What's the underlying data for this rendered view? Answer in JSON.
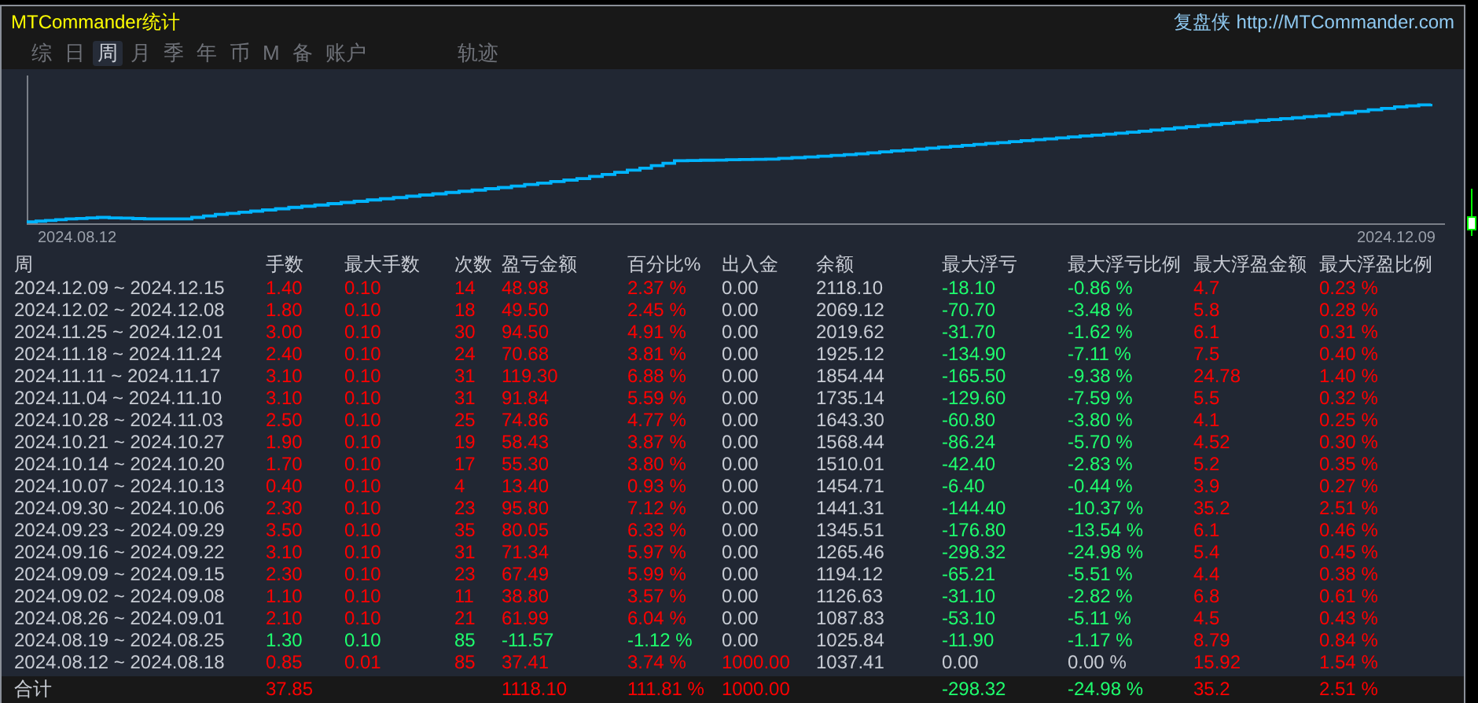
{
  "window": {
    "title": "MTCommander统计",
    "brand": "复盘侠",
    "link": "http://MTCommander.com"
  },
  "tabs": [
    {
      "label": "综",
      "selected": false
    },
    {
      "label": "日",
      "selected": false
    },
    {
      "label": "周",
      "selected": true
    },
    {
      "label": "月",
      "selected": false
    },
    {
      "label": "季",
      "selected": false
    },
    {
      "label": "年",
      "selected": false
    },
    {
      "label": "币",
      "selected": false
    },
    {
      "label": "M",
      "selected": false
    },
    {
      "label": "备",
      "selected": false
    },
    {
      "label": "账户",
      "selected": false
    },
    {
      "label": "轨迹",
      "selected": false
    }
  ],
  "chart": {
    "start_label": "2024.08.12",
    "end_label": "2024.12.09"
  },
  "table": {
    "columns": [
      "周",
      "手数",
      "最大手数",
      "次数",
      "盈亏金额",
      "百分比%",
      "出入金",
      "余额",
      "最大浮亏",
      "最大浮亏比例",
      "最大浮盈金额",
      "最大浮盈比例"
    ],
    "rows": [
      {
        "cells": [
          {
            "text": "2024.12.09 ~ 2024.12.15",
            "color": "#c8ccd4"
          },
          {
            "text": "1.40",
            "color": "#ff0000"
          },
          {
            "text": "0.10",
            "color": "#ff0000"
          },
          {
            "text": "14",
            "color": "#ff0000"
          },
          {
            "text": "48.98",
            "color": "#ff0000"
          },
          {
            "text": "2.37 %",
            "color": "#ff0000"
          },
          {
            "text": "0.00",
            "color": "#c8ccd4"
          },
          {
            "text": "2118.10",
            "color": "#c8ccd4"
          },
          {
            "text": "-18.10",
            "color": "#1eff6e"
          },
          {
            "text": "-0.86 %",
            "color": "#1eff6e"
          },
          {
            "text": "4.7",
            "color": "#ff0000"
          },
          {
            "text": "0.23 %",
            "color": "#ff0000"
          }
        ]
      },
      {
        "cells": [
          {
            "text": "2024.12.02 ~ 2024.12.08",
            "color": "#c8ccd4"
          },
          {
            "text": "1.80",
            "color": "#ff0000"
          },
          {
            "text": "0.10",
            "color": "#ff0000"
          },
          {
            "text": "18",
            "color": "#ff0000"
          },
          {
            "text": "49.50",
            "color": "#ff0000"
          },
          {
            "text": "2.45 %",
            "color": "#ff0000"
          },
          {
            "text": "0.00",
            "color": "#c8ccd4"
          },
          {
            "text": "2069.12",
            "color": "#c8ccd4"
          },
          {
            "text": "-70.70",
            "color": "#1eff6e"
          },
          {
            "text": "-3.48 %",
            "color": "#1eff6e"
          },
          {
            "text": "5.8",
            "color": "#ff0000"
          },
          {
            "text": "0.28 %",
            "color": "#ff0000"
          }
        ]
      },
      {
        "cells": [
          {
            "text": "2024.11.25 ~ 2024.12.01",
            "color": "#c8ccd4"
          },
          {
            "text": "3.00",
            "color": "#ff0000"
          },
          {
            "text": "0.10",
            "color": "#ff0000"
          },
          {
            "text": "30",
            "color": "#ff0000"
          },
          {
            "text": "94.50",
            "color": "#ff0000"
          },
          {
            "text": "4.91 %",
            "color": "#ff0000"
          },
          {
            "text": "0.00",
            "color": "#c8ccd4"
          },
          {
            "text": "2019.62",
            "color": "#c8ccd4"
          },
          {
            "text": "-31.70",
            "color": "#1eff6e"
          },
          {
            "text": "-1.62 %",
            "color": "#1eff6e"
          },
          {
            "text": "6.1",
            "color": "#ff0000"
          },
          {
            "text": "0.31 %",
            "color": "#ff0000"
          }
        ]
      },
      {
        "cells": [
          {
            "text": "2024.11.18 ~ 2024.11.24",
            "color": "#c8ccd4"
          },
          {
            "text": "2.40",
            "color": "#ff0000"
          },
          {
            "text": "0.10",
            "color": "#ff0000"
          },
          {
            "text": "24",
            "color": "#ff0000"
          },
          {
            "text": "70.68",
            "color": "#ff0000"
          },
          {
            "text": "3.81 %",
            "color": "#ff0000"
          },
          {
            "text": "0.00",
            "color": "#c8ccd4"
          },
          {
            "text": "1925.12",
            "color": "#c8ccd4"
          },
          {
            "text": "-134.90",
            "color": "#1eff6e"
          },
          {
            "text": "-7.11 %",
            "color": "#1eff6e"
          },
          {
            "text": "7.5",
            "color": "#ff0000"
          },
          {
            "text": "0.40 %",
            "color": "#ff0000"
          }
        ]
      },
      {
        "cells": [
          {
            "text": "2024.11.11 ~ 2024.11.17",
            "color": "#c8ccd4"
          },
          {
            "text": "3.10",
            "color": "#ff0000"
          },
          {
            "text": "0.10",
            "color": "#ff0000"
          },
          {
            "text": "31",
            "color": "#ff0000"
          },
          {
            "text": "119.30",
            "color": "#ff0000"
          },
          {
            "text": "6.88 %",
            "color": "#ff0000"
          },
          {
            "text": "0.00",
            "color": "#c8ccd4"
          },
          {
            "text": "1854.44",
            "color": "#c8ccd4"
          },
          {
            "text": "-165.50",
            "color": "#1eff6e"
          },
          {
            "text": "-9.38 %",
            "color": "#1eff6e"
          },
          {
            "text": "24.78",
            "color": "#ff0000"
          },
          {
            "text": "1.40 %",
            "color": "#ff0000"
          }
        ]
      },
      {
        "cells": [
          {
            "text": "2024.11.04 ~ 2024.11.10",
            "color": "#c8ccd4"
          },
          {
            "text": "3.10",
            "color": "#ff0000"
          },
          {
            "text": "0.10",
            "color": "#ff0000"
          },
          {
            "text": "31",
            "color": "#ff0000"
          },
          {
            "text": "91.84",
            "color": "#ff0000"
          },
          {
            "text": "5.59 %",
            "color": "#ff0000"
          },
          {
            "text": "0.00",
            "color": "#c8ccd4"
          },
          {
            "text": "1735.14",
            "color": "#c8ccd4"
          },
          {
            "text": "-129.60",
            "color": "#1eff6e"
          },
          {
            "text": "-7.59 %",
            "color": "#1eff6e"
          },
          {
            "text": "5.5",
            "color": "#ff0000"
          },
          {
            "text": "0.32 %",
            "color": "#ff0000"
          }
        ]
      },
      {
        "cells": [
          {
            "text": "2024.10.28 ~ 2024.11.03",
            "color": "#c8ccd4"
          },
          {
            "text": "2.50",
            "color": "#ff0000"
          },
          {
            "text": "0.10",
            "color": "#ff0000"
          },
          {
            "text": "25",
            "color": "#ff0000"
          },
          {
            "text": "74.86",
            "color": "#ff0000"
          },
          {
            "text": "4.77 %",
            "color": "#ff0000"
          },
          {
            "text": "0.00",
            "color": "#c8ccd4"
          },
          {
            "text": "1643.30",
            "color": "#c8ccd4"
          },
          {
            "text": "-60.80",
            "color": "#1eff6e"
          },
          {
            "text": "-3.80 %",
            "color": "#1eff6e"
          },
          {
            "text": "4.1",
            "color": "#ff0000"
          },
          {
            "text": "0.25 %",
            "color": "#ff0000"
          }
        ]
      },
      {
        "cells": [
          {
            "text": "2024.10.21 ~ 2024.10.27",
            "color": "#c8ccd4"
          },
          {
            "text": "1.90",
            "color": "#ff0000"
          },
          {
            "text": "0.10",
            "color": "#ff0000"
          },
          {
            "text": "19",
            "color": "#ff0000"
          },
          {
            "text": "58.43",
            "color": "#ff0000"
          },
          {
            "text": "3.87 %",
            "color": "#ff0000"
          },
          {
            "text": "0.00",
            "color": "#c8ccd4"
          },
          {
            "text": "1568.44",
            "color": "#c8ccd4"
          },
          {
            "text": "-86.24",
            "color": "#1eff6e"
          },
          {
            "text": "-5.70 %",
            "color": "#1eff6e"
          },
          {
            "text": "4.52",
            "color": "#ff0000"
          },
          {
            "text": "0.30 %",
            "color": "#ff0000"
          }
        ]
      },
      {
        "cells": [
          {
            "text": "2024.10.14 ~ 2024.10.20",
            "color": "#c8ccd4"
          },
          {
            "text": "1.70",
            "color": "#ff0000"
          },
          {
            "text": "0.10",
            "color": "#ff0000"
          },
          {
            "text": "17",
            "color": "#ff0000"
          },
          {
            "text": "55.30",
            "color": "#ff0000"
          },
          {
            "text": "3.80 %",
            "color": "#ff0000"
          },
          {
            "text": "0.00",
            "color": "#c8ccd4"
          },
          {
            "text": "1510.01",
            "color": "#c8ccd4"
          },
          {
            "text": "-42.40",
            "color": "#1eff6e"
          },
          {
            "text": "-2.83 %",
            "color": "#1eff6e"
          },
          {
            "text": "5.2",
            "color": "#ff0000"
          },
          {
            "text": "0.35 %",
            "color": "#ff0000"
          }
        ]
      },
      {
        "cells": [
          {
            "text": "2024.10.07 ~ 2024.10.13",
            "color": "#c8ccd4"
          },
          {
            "text": "0.40",
            "color": "#ff0000"
          },
          {
            "text": "0.10",
            "color": "#ff0000"
          },
          {
            "text": "4",
            "color": "#ff0000"
          },
          {
            "text": "13.40",
            "color": "#ff0000"
          },
          {
            "text": "0.93 %",
            "color": "#ff0000"
          },
          {
            "text": "0.00",
            "color": "#c8ccd4"
          },
          {
            "text": "1454.71",
            "color": "#c8ccd4"
          },
          {
            "text": "-6.40",
            "color": "#1eff6e"
          },
          {
            "text": "-0.44 %",
            "color": "#1eff6e"
          },
          {
            "text": "3.9",
            "color": "#ff0000"
          },
          {
            "text": "0.27 %",
            "color": "#ff0000"
          }
        ]
      },
      {
        "cells": [
          {
            "text": "2024.09.30 ~ 2024.10.06",
            "color": "#c8ccd4"
          },
          {
            "text": "2.30",
            "color": "#ff0000"
          },
          {
            "text": "0.10",
            "color": "#ff0000"
          },
          {
            "text": "23",
            "color": "#ff0000"
          },
          {
            "text": "95.80",
            "color": "#ff0000"
          },
          {
            "text": "7.12 %",
            "color": "#ff0000"
          },
          {
            "text": "0.00",
            "color": "#c8ccd4"
          },
          {
            "text": "1441.31",
            "color": "#c8ccd4"
          },
          {
            "text": "-144.40",
            "color": "#1eff6e"
          },
          {
            "text": "-10.37 %",
            "color": "#1eff6e"
          },
          {
            "text": "35.2",
            "color": "#ff0000"
          },
          {
            "text": "2.51 %",
            "color": "#ff0000"
          }
        ]
      },
      {
        "cells": [
          {
            "text": "2024.09.23 ~ 2024.09.29",
            "color": "#c8ccd4"
          },
          {
            "text": "3.50",
            "color": "#ff0000"
          },
          {
            "text": "0.10",
            "color": "#ff0000"
          },
          {
            "text": "35",
            "color": "#ff0000"
          },
          {
            "text": "80.05",
            "color": "#ff0000"
          },
          {
            "text": "6.33 %",
            "color": "#ff0000"
          },
          {
            "text": "0.00",
            "color": "#c8ccd4"
          },
          {
            "text": "1345.51",
            "color": "#c8ccd4"
          },
          {
            "text": "-176.80",
            "color": "#1eff6e"
          },
          {
            "text": "-13.54 %",
            "color": "#1eff6e"
          },
          {
            "text": "6.1",
            "color": "#ff0000"
          },
          {
            "text": "0.46 %",
            "color": "#ff0000"
          }
        ]
      },
      {
        "cells": [
          {
            "text": "2024.09.16 ~ 2024.09.22",
            "color": "#c8ccd4"
          },
          {
            "text": "3.10",
            "color": "#ff0000"
          },
          {
            "text": "0.10",
            "color": "#ff0000"
          },
          {
            "text": "31",
            "color": "#ff0000"
          },
          {
            "text": "71.34",
            "color": "#ff0000"
          },
          {
            "text": "5.97 %",
            "color": "#ff0000"
          },
          {
            "text": "0.00",
            "color": "#c8ccd4"
          },
          {
            "text": "1265.46",
            "color": "#c8ccd4"
          },
          {
            "text": "-298.32",
            "color": "#1eff6e"
          },
          {
            "text": "-24.98 %",
            "color": "#1eff6e"
          },
          {
            "text": "5.4",
            "color": "#ff0000"
          },
          {
            "text": "0.45 %",
            "color": "#ff0000"
          }
        ]
      },
      {
        "cells": [
          {
            "text": "2024.09.09 ~ 2024.09.15",
            "color": "#c8ccd4"
          },
          {
            "text": "2.30",
            "color": "#ff0000"
          },
          {
            "text": "0.10",
            "color": "#ff0000"
          },
          {
            "text": "23",
            "color": "#ff0000"
          },
          {
            "text": "67.49",
            "color": "#ff0000"
          },
          {
            "text": "5.99 %",
            "color": "#ff0000"
          },
          {
            "text": "0.00",
            "color": "#c8ccd4"
          },
          {
            "text": "1194.12",
            "color": "#c8ccd4"
          },
          {
            "text": "-65.21",
            "color": "#1eff6e"
          },
          {
            "text": "-5.51 %",
            "color": "#1eff6e"
          },
          {
            "text": "4.4",
            "color": "#ff0000"
          },
          {
            "text": "0.38 %",
            "color": "#ff0000"
          }
        ]
      },
      {
        "cells": [
          {
            "text": "2024.09.02 ~ 2024.09.08",
            "color": "#c8ccd4"
          },
          {
            "text": "1.10",
            "color": "#ff0000"
          },
          {
            "text": "0.10",
            "color": "#ff0000"
          },
          {
            "text": "11",
            "color": "#ff0000"
          },
          {
            "text": "38.80",
            "color": "#ff0000"
          },
          {
            "text": "3.57 %",
            "color": "#ff0000"
          },
          {
            "text": "0.00",
            "color": "#c8ccd4"
          },
          {
            "text": "1126.63",
            "color": "#c8ccd4"
          },
          {
            "text": "-31.10",
            "color": "#1eff6e"
          },
          {
            "text": "-2.82 %",
            "color": "#1eff6e"
          },
          {
            "text": "6.8",
            "color": "#ff0000"
          },
          {
            "text": "0.61 %",
            "color": "#ff0000"
          }
        ]
      },
      {
        "cells": [
          {
            "text": "2024.08.26 ~ 2024.09.01",
            "color": "#c8ccd4"
          },
          {
            "text": "2.10",
            "color": "#ff0000"
          },
          {
            "text": "0.10",
            "color": "#ff0000"
          },
          {
            "text": "21",
            "color": "#ff0000"
          },
          {
            "text": "61.99",
            "color": "#ff0000"
          },
          {
            "text": "6.04 %",
            "color": "#ff0000"
          },
          {
            "text": "0.00",
            "color": "#c8ccd4"
          },
          {
            "text": "1087.83",
            "color": "#c8ccd4"
          },
          {
            "text": "-53.10",
            "color": "#1eff6e"
          },
          {
            "text": "-5.11 %",
            "color": "#1eff6e"
          },
          {
            "text": "4.5",
            "color": "#ff0000"
          },
          {
            "text": "0.43 %",
            "color": "#ff0000"
          }
        ]
      },
      {
        "cells": [
          {
            "text": "2024.08.19 ~ 2024.08.25",
            "color": "#c8ccd4"
          },
          {
            "text": "1.30",
            "color": "#1eff6e"
          },
          {
            "text": "0.10",
            "color": "#1eff6e"
          },
          {
            "text": "85",
            "color": "#1eff6e"
          },
          {
            "text": "-11.57",
            "color": "#1eff6e"
          },
          {
            "text": "-1.12 %",
            "color": "#1eff6e"
          },
          {
            "text": "0.00",
            "color": "#c8ccd4"
          },
          {
            "text": "1025.84",
            "color": "#c8ccd4"
          },
          {
            "text": "-11.90",
            "color": "#1eff6e"
          },
          {
            "text": "-1.17 %",
            "color": "#1eff6e"
          },
          {
            "text": "8.79",
            "color": "#ff0000"
          },
          {
            "text": "0.84 %",
            "color": "#ff0000"
          }
        ]
      },
      {
        "cells": [
          {
            "text": "2024.08.12 ~ 2024.08.18",
            "color": "#c8ccd4"
          },
          {
            "text": "0.85",
            "color": "#ff0000"
          },
          {
            "text": "0.01",
            "color": "#ff0000"
          },
          {
            "text": "85",
            "color": "#ff0000"
          },
          {
            "text": "37.41",
            "color": "#ff0000"
          },
          {
            "text": "3.74 %",
            "color": "#ff0000"
          },
          {
            "text": "1000.00",
            "color": "#ff0000"
          },
          {
            "text": "1037.41",
            "color": "#c8ccd4"
          },
          {
            "text": "0.00",
            "color": "#c8ccd4"
          },
          {
            "text": "0.00 %",
            "color": "#c8ccd4"
          },
          {
            "text": "15.92",
            "color": "#ff0000"
          },
          {
            "text": "1.54 %",
            "color": "#ff0000"
          }
        ]
      }
    ],
    "total": {
      "cells": [
        {
          "text": "合计",
          "color": "#c8ccd4"
        },
        {
          "text": "37.85",
          "color": "#ff0000"
        },
        null,
        null,
        {
          "text": "1118.10",
          "color": "#ff0000"
        },
        {
          "text": "111.81 %",
          "color": "#ff0000"
        },
        {
          "text": "1000.00",
          "color": "#ff0000"
        },
        null,
        {
          "text": "-298.32",
          "color": "#1eff6e"
        },
        {
          "text": "-24.98 %",
          "color": "#1eff6e"
        },
        {
          "text": "35.2",
          "color": "#ff0000"
        },
        {
          "text": "2.51 %",
          "color": "#ff0000"
        }
      ]
    }
  }
}
